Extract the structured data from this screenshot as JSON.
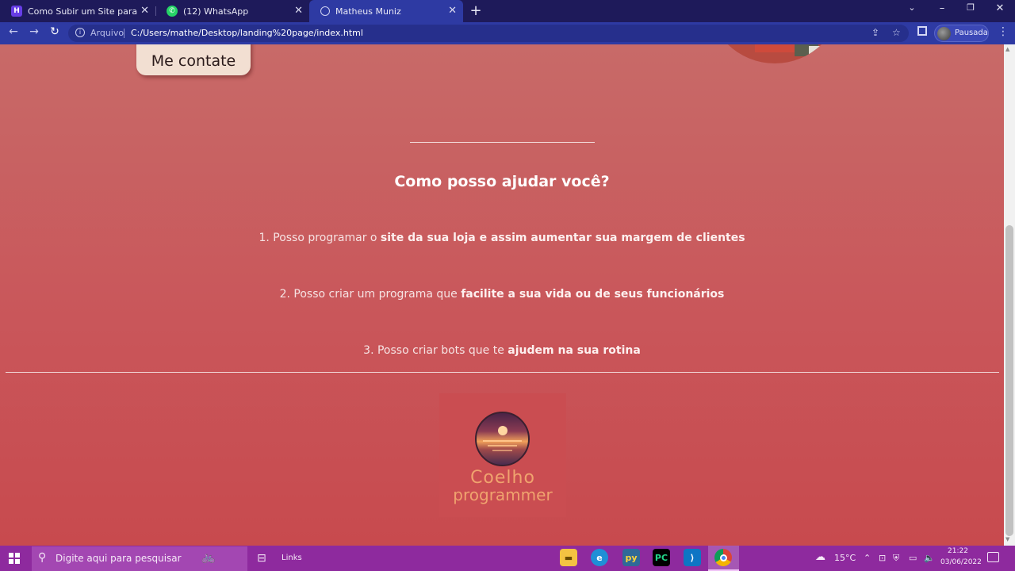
{
  "browser": {
    "tabs": [
      {
        "title": "Como Subir um Site para o Servi",
        "favicon": "hostinger-icon",
        "active": false
      },
      {
        "title": "(12) WhatsApp",
        "favicon": "whatsapp-icon",
        "active": false
      },
      {
        "title": "Matheus Muniz",
        "favicon": "globe-icon",
        "active": true
      }
    ],
    "omnibox": {
      "prefix": "Arquivo",
      "url": "C:/Users/mathe/Desktop/landing%20page/index.html"
    },
    "profile_label": "Pausada"
  },
  "page": {
    "cta_label": "Me contate",
    "section_heading": "Como posso ajudar você?",
    "points": [
      {
        "plain": "1. Posso programar o ",
        "bold": "site da sua loja e assim aumentar sua margem de clientes"
      },
      {
        "plain": "2. Posso criar um programa que ",
        "bold": "facilite a sua vida ou de seus funcionários"
      },
      {
        "plain": "3. Posso criar bots que te ",
        "bold": "ajudem na sua rotina"
      }
    ],
    "logo": {
      "title": "Coelho",
      "subtitle": "programmer"
    },
    "colors": {
      "background": "#c9565a",
      "cta_background": "#f2dfd2",
      "logo_text": "#f0a36e"
    }
  },
  "taskbar": {
    "search_placeholder": "Digite aqui para pesquisar",
    "links_label": "Links",
    "pinned_apps": [
      "file-explorer-icon",
      "edge-icon",
      "python-icon",
      "pycharm-icon",
      "vscode-icon",
      "chrome-icon"
    ],
    "weather": "15°C",
    "time": "21:22",
    "date": "03/06/2022"
  }
}
